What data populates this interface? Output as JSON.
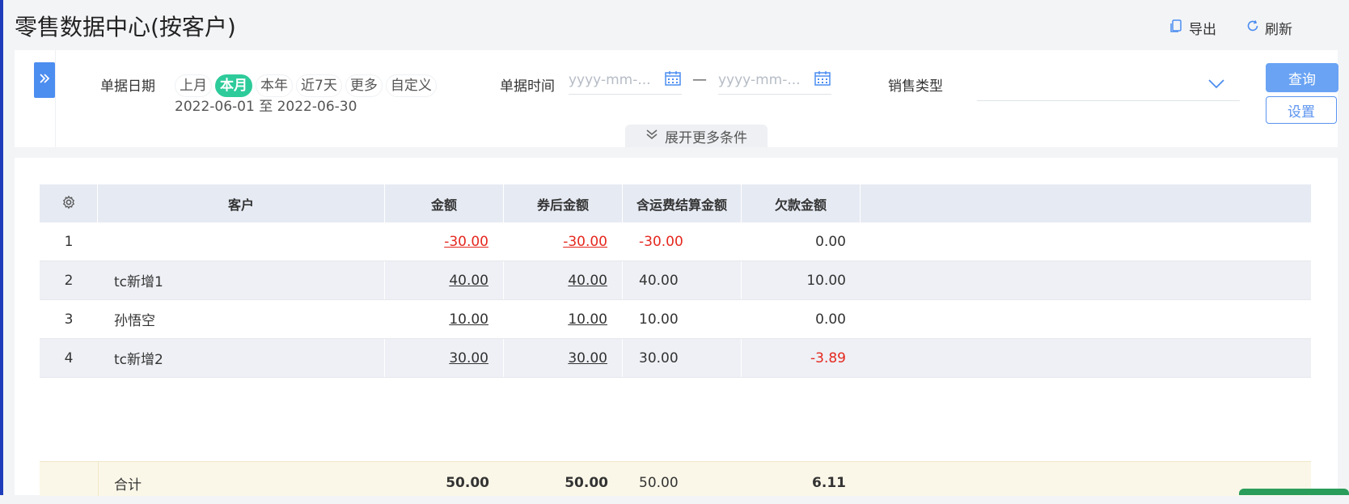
{
  "header": {
    "title": "零售数据中心(按客户)",
    "actions": [
      {
        "label": "导出",
        "icon": "export-icon"
      },
      {
        "label": "刷新",
        "icon": "refresh-icon"
      }
    ]
  },
  "filters": {
    "doc_date_label": "单据日期",
    "date_chips": [
      "上月",
      "本月",
      "本年",
      "近7天",
      "更多",
      "自定义"
    ],
    "active_chip": "本月",
    "date_range": "2022-06-01 至 2022-06-30",
    "doc_time_label": "单据时间",
    "start_placeholder": "yyyy-mm-...",
    "end_placeholder": "yyyy-mm-...",
    "range_dash": "—",
    "sales_type_label": "销售类型",
    "sales_type_value": "",
    "query_label": "查询",
    "settings_label": "设置",
    "more_conditions_label": "展开更多条件"
  },
  "table": {
    "columns": [
      "客户",
      "金额",
      "券后金额",
      "含运费结算金额",
      "欠款金额"
    ],
    "rows": [
      {
        "idx": "1",
        "customer": "",
        "amount": "-30.00",
        "after_coupon": "-30.00",
        "settle": "-30.00",
        "debt": "0.00"
      },
      {
        "idx": "2",
        "customer": "tc新增1",
        "amount": "40.00",
        "after_coupon": "40.00",
        "settle": "40.00",
        "debt": "10.00"
      },
      {
        "idx": "3",
        "customer": "孙悟空",
        "amount": "10.00",
        "after_coupon": "10.00",
        "settle": "10.00",
        "debt": "0.00"
      },
      {
        "idx": "4",
        "customer": "tc新增2",
        "amount": "30.00",
        "after_coupon": "30.00",
        "settle": "30.00",
        "debt": "-3.89"
      }
    ],
    "total": {
      "label": "合计",
      "amount": "50.00",
      "after_coupon": "50.00",
      "settle": "50.00",
      "debt": "6.11"
    }
  },
  "colors": {
    "accent": "#4c8df0",
    "active_chip": "#2ecb9a",
    "negative": "#e5281f",
    "header_bg": "#e6eaf3"
  }
}
